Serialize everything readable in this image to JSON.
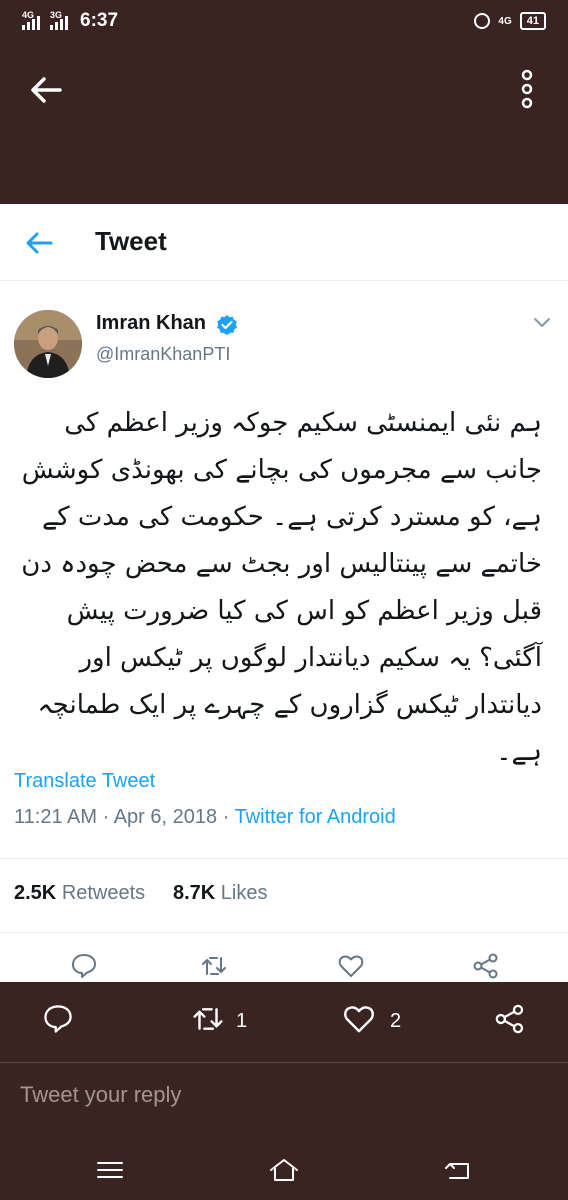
{
  "status_bar": {
    "network_1": "4G",
    "network_2": "3G",
    "time": "6:37",
    "network_right": "4G",
    "battery": "41"
  },
  "header": {
    "title": "Tweet"
  },
  "tweet": {
    "author_name": "Imran Khan",
    "author_handle": "@ImranKhanPTI",
    "text": "ہم نئی ایمنسٹی سکیم جوکہ وزیر اعظم کی جانب سے مجرموں کی بچانے کی بھونڈی کوشش ہے، کو مسترد کرتی ہے۔ حکومت کی مدت کے خاتمے سے پینتالیس اور بجٹ سے محض چودہ دن قبل وزیر اعظم کو اس کی کیا ضرورت پیش آگئی؟ یہ سکیم دیانتدار لوگوں پر ٹیکس اور دیانتدار ٹیکس گزاروں کے چہرے پر ایک طمانچہ ہے۔",
    "translate_label": "Translate Tweet",
    "time": "11:21 AM",
    "date": "Apr 6, 2018",
    "source": "Twitter for Android",
    "retweets_count": "2.5K",
    "retweets_label": "Retweets",
    "likes_count": "8.7K",
    "likes_label": "Likes"
  },
  "bottom_actions": {
    "retweet_count": "1",
    "like_count": "2"
  },
  "reply": {
    "placeholder": "Tweet your reply"
  },
  "colors": {
    "accent": "#1da1f2",
    "frame": "#3a2421",
    "text": "#14171a",
    "muted": "#657786"
  }
}
